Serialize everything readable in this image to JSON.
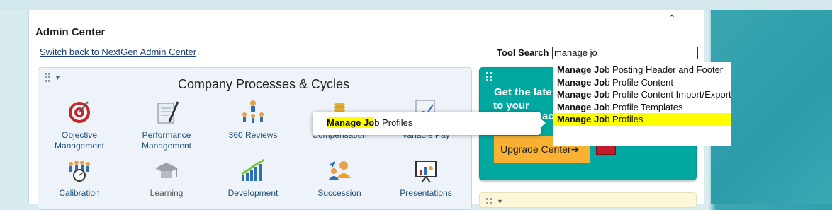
{
  "header": {
    "title": "Admin Center",
    "switch_link": "Switch back to NextGen Admin Center",
    "tool_search_label": "Tool Search",
    "tool_search_value": "manage jo"
  },
  "tile": {
    "title": "Company Processes & Cycles",
    "items": [
      {
        "label": "Objective\nManagement",
        "icon": "target-icon"
      },
      {
        "label": "Performance\nManagement",
        "icon": "document-pen-icon"
      },
      {
        "label": "360 Reviews",
        "icon": "people-network-icon"
      },
      {
        "label": "Compensation",
        "icon": "coins-icon"
      },
      {
        "label": "Variable Pay",
        "icon": "chart-doc-icon"
      },
      {
        "label": "Calibration",
        "icon": "calibration-group-icon"
      },
      {
        "label": "Learning",
        "icon": "graduation-cap-icon"
      },
      {
        "label": "Development",
        "icon": "growth-chart-icon"
      },
      {
        "label": "Succession",
        "icon": "succession-people-icon"
      },
      {
        "label": "Presentations",
        "icon": "presentation-board-icon"
      }
    ]
  },
  "card": {
    "line1": "Get the late",
    "line2": "to your",
    "fragment": "ac",
    "button": "Upgrade Center",
    "button_arrow": "➔"
  },
  "dropdown": {
    "match": "Manage Jo",
    "items": [
      {
        "rest": "b Posting Header and Footer",
        "selected": false
      },
      {
        "rest": "b Profile Content",
        "selected": false
      },
      {
        "rest": "b Profile Content Import/Export",
        "selected": false
      },
      {
        "rest": "b Profile Templates",
        "selected": false
      },
      {
        "rest": "b Profiles",
        "selected": true
      }
    ]
  },
  "popup": {
    "highlight": "Manage Jo",
    "rest": "b Profiles"
  },
  "colors": {
    "teal_card": "#00a8a0",
    "upgrade_button": "#f8b133",
    "highlight": "#ffff00",
    "link": "#1a3f73"
  },
  "collapse_icon": "^"
}
